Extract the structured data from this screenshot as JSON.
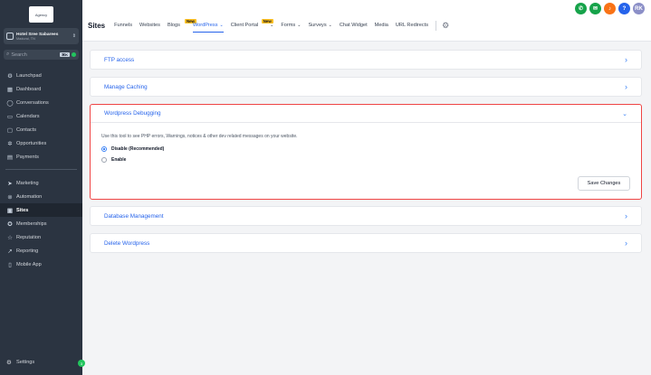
{
  "sidebar": {
    "logo_text": "Agency",
    "location": {
      "name": "Hotel Sree Sabarees",
      "sub": "Madurai, TN"
    },
    "search": {
      "placeholder": "Search",
      "shortcut": "⌘K"
    },
    "nav_top": [
      {
        "label": "Launchpad",
        "icon": "rocket-icon",
        "glyph": "⚙"
      },
      {
        "label": "Dashboard",
        "icon": "dashboard-icon",
        "glyph": "▦"
      },
      {
        "label": "Conversations",
        "icon": "chat-icon",
        "glyph": "◯"
      },
      {
        "label": "Calendars",
        "icon": "calendar-icon",
        "glyph": "▭"
      },
      {
        "label": "Contacts",
        "icon": "contacts-icon",
        "glyph": "▢"
      },
      {
        "label": "Opportunities",
        "icon": "opportunities-icon",
        "glyph": "✲"
      },
      {
        "label": "Payments",
        "icon": "payments-icon",
        "glyph": "▤"
      }
    ],
    "nav_bottom": [
      {
        "label": "Marketing",
        "icon": "send-icon",
        "glyph": "➤",
        "active": false
      },
      {
        "label": "Automation",
        "icon": "automation-icon",
        "glyph": "⊚",
        "active": false
      },
      {
        "label": "Sites",
        "icon": "sites-icon",
        "glyph": "▣",
        "active": true
      },
      {
        "label": "Memberships",
        "icon": "memberships-icon",
        "glyph": "✪",
        "active": false
      },
      {
        "label": "Reputation",
        "icon": "star-icon",
        "glyph": "☆",
        "active": false
      },
      {
        "label": "Reporting",
        "icon": "reporting-icon",
        "glyph": "↗",
        "active": false
      },
      {
        "label": "Mobile App",
        "icon": "mobile-icon",
        "glyph": "▯",
        "active": false
      }
    ],
    "settings_label": "Settings",
    "notification_count": "3"
  },
  "header": {
    "title": "Sites",
    "tabs": [
      {
        "label": "Funnels"
      },
      {
        "label": "Websites"
      },
      {
        "label": "Blogs",
        "badge": "New"
      },
      {
        "label": "WordPress",
        "active": true,
        "chevron": true
      },
      {
        "label": "Client Portal",
        "badge": "New",
        "chevron": true
      },
      {
        "label": "Forms",
        "chevron": true
      },
      {
        "label": "Surveys",
        "chevron": true
      },
      {
        "label": "Chat Widget"
      },
      {
        "label": "Media"
      },
      {
        "label": "URL Redirects"
      }
    ],
    "avatar_initials": "RK",
    "colors": {
      "phone": "#16a34a",
      "megaphone": "#16a34a",
      "bell": "#f97316",
      "help": "#2563eb",
      "avatar": "#8b8fc7"
    }
  },
  "main": {
    "cards": [
      {
        "title": "FTP access"
      },
      {
        "title": "Manage Caching"
      },
      {
        "title": "Wordpress Debugging",
        "description": "Use this tool to see PHP errors, Warnings, notices & other dev related messages on your website.",
        "options": [
          "Disable (Recommended)",
          "Enable"
        ],
        "selected": "Disable (Recommended)",
        "save_label": "Save Changes"
      },
      {
        "title": "Database Management"
      },
      {
        "title": "Delete Wordpress"
      }
    ]
  }
}
